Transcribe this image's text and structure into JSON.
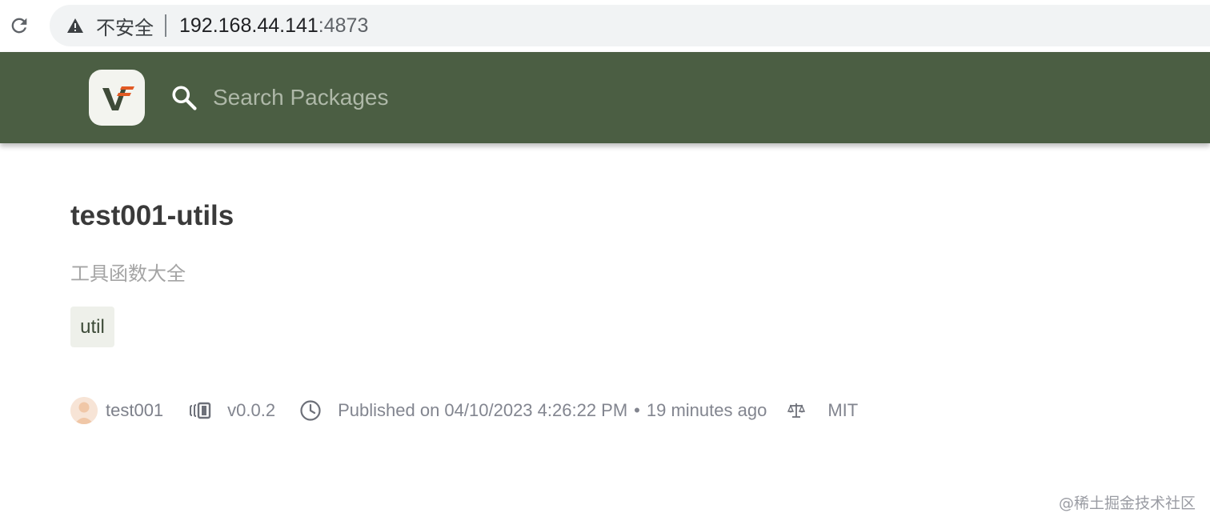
{
  "browser": {
    "insecure_label": "不安全",
    "url_host": "192.168.44.141",
    "url_port": ":4873"
  },
  "header": {
    "search_placeholder": "Search Packages"
  },
  "package": {
    "name": "test001-utils",
    "description": "工具函数大全",
    "keywords": [
      "util"
    ],
    "author": "test001",
    "version": "v0.0.2",
    "published": "Published on 04/10/2023 4:26:22 PM",
    "separator": "•",
    "relative_time": "19 minutes ago",
    "license": "MIT"
  },
  "watermark": "@稀土掘金技术社区",
  "colors": {
    "header_bg": "#4b5e43",
    "logo_accent": "#e25a24",
    "text_muted": "#82858f"
  }
}
